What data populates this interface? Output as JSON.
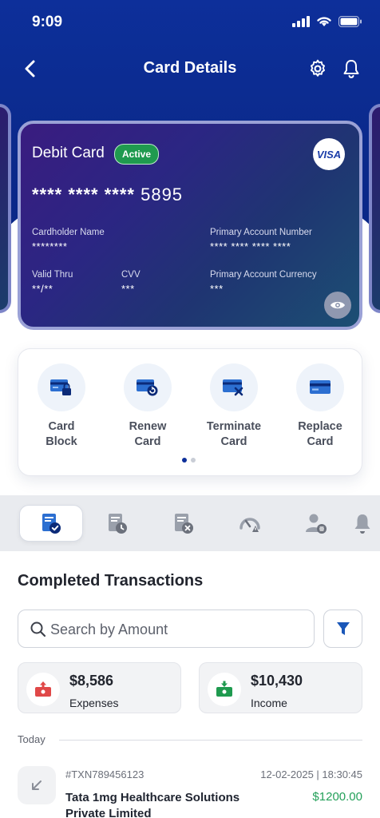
{
  "status_bar": {
    "time": "9:09"
  },
  "nav": {
    "title": "Card Details"
  },
  "card": {
    "type": "Debit Card",
    "status": "Active",
    "network": "VISA",
    "masked_number": "**** **** ****",
    "last4": "5895",
    "cardholder_label": "Cardholder Name",
    "cardholder_value": "********",
    "pan_label": "Primary Account Number",
    "pan_value": "**** **** **** ****",
    "valid_label": "Valid Thru",
    "valid_value": "**/**",
    "cvv_label": "CVV",
    "cvv_value": "***",
    "currency_label": "Primary Account Currency",
    "currency_value": "***"
  },
  "actions": [
    {
      "label": "Card\nBlock",
      "icon": "card-lock-icon"
    },
    {
      "label": "Renew\nCard",
      "icon": "card-renew-icon"
    },
    {
      "label": "Terminate\nCard",
      "icon": "card-terminate-icon"
    },
    {
      "label": "Replace\nCard",
      "icon": "card-replace-icon"
    }
  ],
  "tabs": [
    {
      "icon": "completed-transactions-icon",
      "active": true
    },
    {
      "icon": "pending-transactions-icon",
      "active": false
    },
    {
      "icon": "failed-transactions-icon",
      "active": false
    },
    {
      "icon": "limits-gauge-icon",
      "active": false
    },
    {
      "icon": "linked-user-icon",
      "active": false
    },
    {
      "icon": "alerts-bell-icon",
      "active": false
    }
  ],
  "section": {
    "title": "Completed Transactions"
  },
  "search": {
    "placeholder": "Search by Amount"
  },
  "stats": {
    "expenses_amount": "$8,586",
    "expenses_label": "Expenses",
    "income_amount": "$10,430",
    "income_label": "Income"
  },
  "group_label": "Today",
  "transaction": {
    "id": "#TXN789456123",
    "date": "12-02-2025 | 18:30:45",
    "name": "Tata 1mg Healthcare Solutions Private Limited",
    "amount": "$1200.00"
  },
  "colors": {
    "header_blue": "#0d2f9a",
    "active_green": "#1f9a4f",
    "income_green": "#24a05a",
    "expense_red": "#e04848"
  }
}
